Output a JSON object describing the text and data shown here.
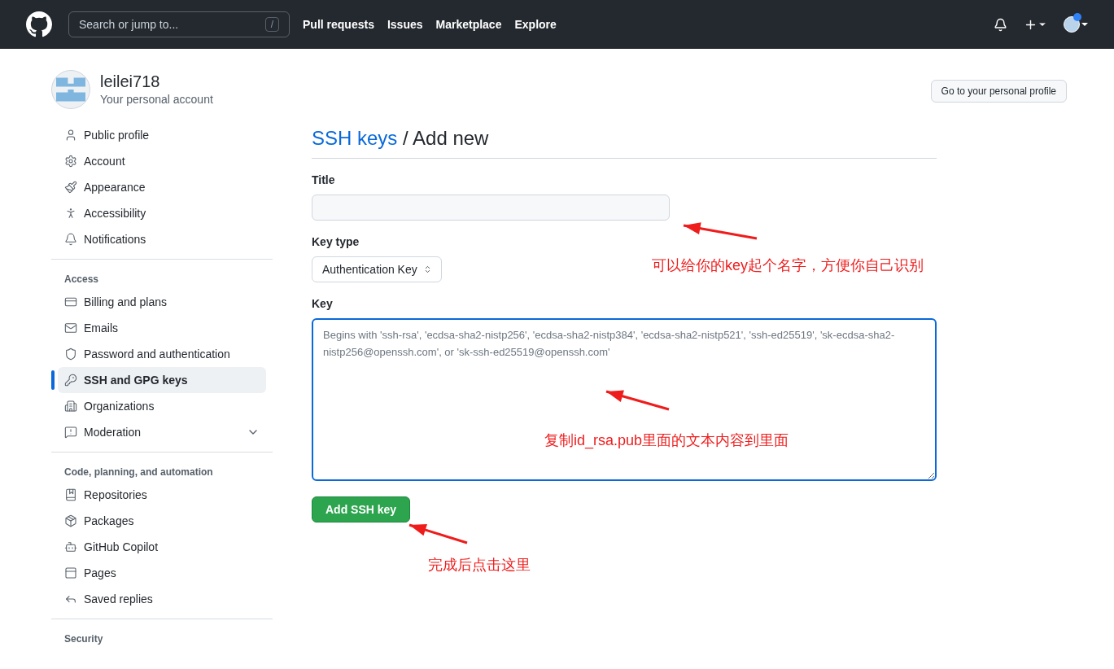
{
  "header": {
    "search": {
      "placeholder": "Search or jump to...",
      "shortcut": "/"
    },
    "nav": [
      "Pull requests",
      "Issues",
      "Marketplace",
      "Explore"
    ]
  },
  "account": {
    "name": "leilei718",
    "subtitle": "Your personal account",
    "profile_button": "Go to your personal profile"
  },
  "sidebar": {
    "sections": [
      {
        "items": [
          {
            "label": "Public profile",
            "kind": "link",
            "selected": false
          },
          {
            "label": "Account",
            "kind": "link",
            "selected": false
          },
          {
            "label": "Appearance",
            "kind": "link",
            "selected": false
          },
          {
            "label": "Accessibility",
            "kind": "link",
            "selected": false
          },
          {
            "label": "Notifications",
            "kind": "link",
            "selected": false
          }
        ]
      },
      {
        "heading": "Access",
        "items": [
          {
            "label": "Billing and plans",
            "kind": "link",
            "selected": false
          },
          {
            "label": "Emails",
            "kind": "link",
            "selected": false
          },
          {
            "label": "Password and authentication",
            "kind": "link",
            "selected": false
          },
          {
            "label": "SSH and GPG keys",
            "kind": "link",
            "selected": true
          },
          {
            "label": "Organizations",
            "kind": "link",
            "selected": false
          },
          {
            "label": "Moderation",
            "kind": "collapsible",
            "selected": false,
            "expanded": false
          }
        ]
      },
      {
        "heading": "Code, planning, and automation",
        "items": [
          {
            "label": "Repositories",
            "kind": "link",
            "selected": false
          },
          {
            "label": "Packages",
            "kind": "link",
            "selected": false
          },
          {
            "label": "GitHub Copilot",
            "kind": "link",
            "selected": false
          },
          {
            "label": "Pages",
            "kind": "link",
            "selected": false
          },
          {
            "label": "Saved replies",
            "kind": "link",
            "selected": false
          }
        ]
      },
      {
        "heading": "Security"
      }
    ]
  },
  "page": {
    "breadcrumb_link": "SSH keys",
    "title": " / Add new",
    "fields": [
      {
        "label": "Title",
        "kind": "input"
      },
      {
        "label": "Key type",
        "kind": "select",
        "value": "Authentication Key"
      },
      {
        "label": "Key",
        "kind": "textarea",
        "focused": true,
        "placeholder": "Begins with 'ssh-rsa', 'ecdsa-sha2-nistp256', 'ecdsa-sha2-nistp384', 'ecdsa-sha2-nistp521', 'ssh-ed25519', 'sk-ecdsa-sha2-nistp256@openssh.com', or 'sk-ssh-ed25519@openssh.com'"
      }
    ],
    "submit": "Add SSH key"
  },
  "annotations": [
    "可以给你的key起个名字，方便你自己识别",
    "复制id_rsa.pub里面的文本内容到里面",
    "完成后点击这里"
  ]
}
